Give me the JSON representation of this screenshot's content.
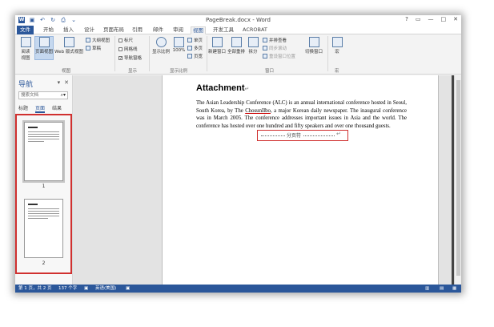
{
  "titlebar": {
    "doc_title": "PageBreak.docx - Word",
    "quick_access": [
      "save",
      "undo",
      "redo",
      "print-preview"
    ],
    "window_buttons": [
      "?",
      "▭",
      "—",
      "□",
      "✕"
    ]
  },
  "tabs": [
    "文件",
    "开始",
    "插入",
    "设计",
    "页面布局",
    "引用",
    "邮件",
    "审阅",
    "视图",
    "开发工具",
    "ACROBAT"
  ],
  "active_tab": "视图",
  "ribbon": {
    "read_mode": "阅读\n视图",
    "print_layout": "页面视图",
    "web_layout": "Web 版式视图",
    "outline": "大纲视图",
    "draft": "草稿",
    "views_group": "视图",
    "ruler": "标尺",
    "gridlines": "网格线",
    "nav_pane": "导航窗格",
    "show_group": "显示",
    "zoom": "显示比例",
    "zoom100": "100%",
    "one_page": "单页",
    "multi_page": "多页",
    "page_width": "页宽",
    "zoom_group": "显示比例",
    "new_window": "新建窗口",
    "arrange_all": "全部重排",
    "split": "拆分",
    "side_by_side": "并排查看",
    "sync_scroll": "同步滚动",
    "reset_pos": "重设窗口位置",
    "switch_windows": "切换窗口",
    "window_group": "窗口",
    "macros": "宏",
    "macro_group": "宏"
  },
  "nav": {
    "title": "导航",
    "search_placeholder": "搜索文档",
    "tabs": [
      "标题",
      "页面",
      "结果"
    ],
    "active_tab": "页面",
    "page_numbers": [
      "1",
      "2"
    ]
  },
  "document": {
    "heading": "Attachment",
    "body_part1": "The Asian Leadership Conference (ALC) is an annual international conference hosted in Seoul, South Korea, by The ",
    "body_underlined": "ChosunIlbo",
    "body_part2": ", a major Korean daily newspaper. The inaugural conference was in March 2005. The conference addresses important issues in Asia and the world. The conference has hosted over one hundred and fifty speakers and over one thousand guests.",
    "page_break_label": "分页符"
  },
  "status": {
    "page": "第 1 页，共 2 页",
    "words": "137 个字",
    "language": "英语(美国)"
  },
  "colors": {
    "accent": "#2b579a",
    "highlight_box": "#d0302f"
  }
}
